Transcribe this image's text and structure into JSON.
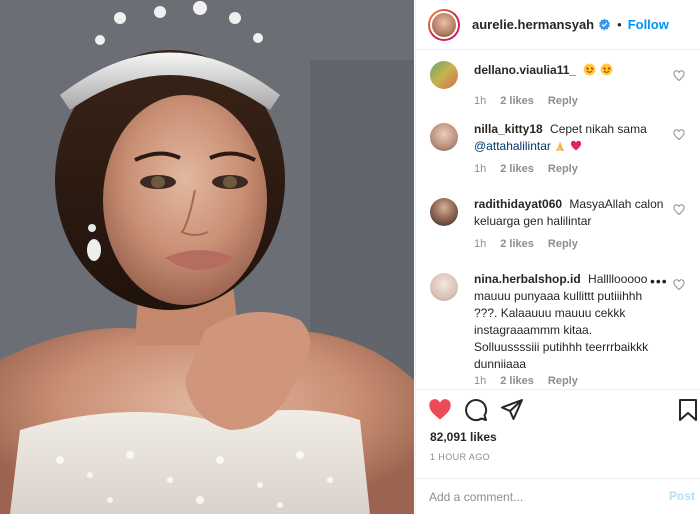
{
  "post": {
    "username": "aurelie.hermansyah",
    "follow_label": "Follow",
    "separator": "•"
  },
  "comments": [
    {
      "user": "dellano.viaulia11_",
      "text": "",
      "emoji": [
        "heart-eyes-icon",
        "heart-eyes-icon"
      ],
      "time": "1h",
      "likes": "2 likes",
      "reply": "Reply"
    },
    {
      "user": "nilla_kitty18",
      "text": "Cepet nikah sama",
      "mention": "@attahalilintar",
      "emoji": [
        "pray-icon",
        "red-heart-icon"
      ],
      "time": "1h",
      "likes": "2 likes",
      "reply": "Reply"
    },
    {
      "user": "radithidayat060",
      "text": "MasyaAllah calon keluarga gen halilintar",
      "time": "1h",
      "likes": "2 likes",
      "reply": "Reply"
    },
    {
      "user": "nina.herbalshop.id",
      "text": "Hallllooooo mauuu punyaaa kullittt putiiihhh ???. Kalaauuu mauuu cekkk instagraaammm kitaa. Solluussssiii putihhh teerrrbaikkk dunniiaaa",
      "more": "•••",
      "time": "1h",
      "likes": "2 likes",
      "reply": "Reply"
    }
  ],
  "actions": {
    "likes": "82,091 likes",
    "time": "1 HOUR AGO",
    "comment_placeholder": "Add a comment...",
    "post_label": "Post"
  },
  "colors": {
    "accent": "#0095f6",
    "like_red": "#ed4956",
    "muted": "#8e8e8e"
  }
}
